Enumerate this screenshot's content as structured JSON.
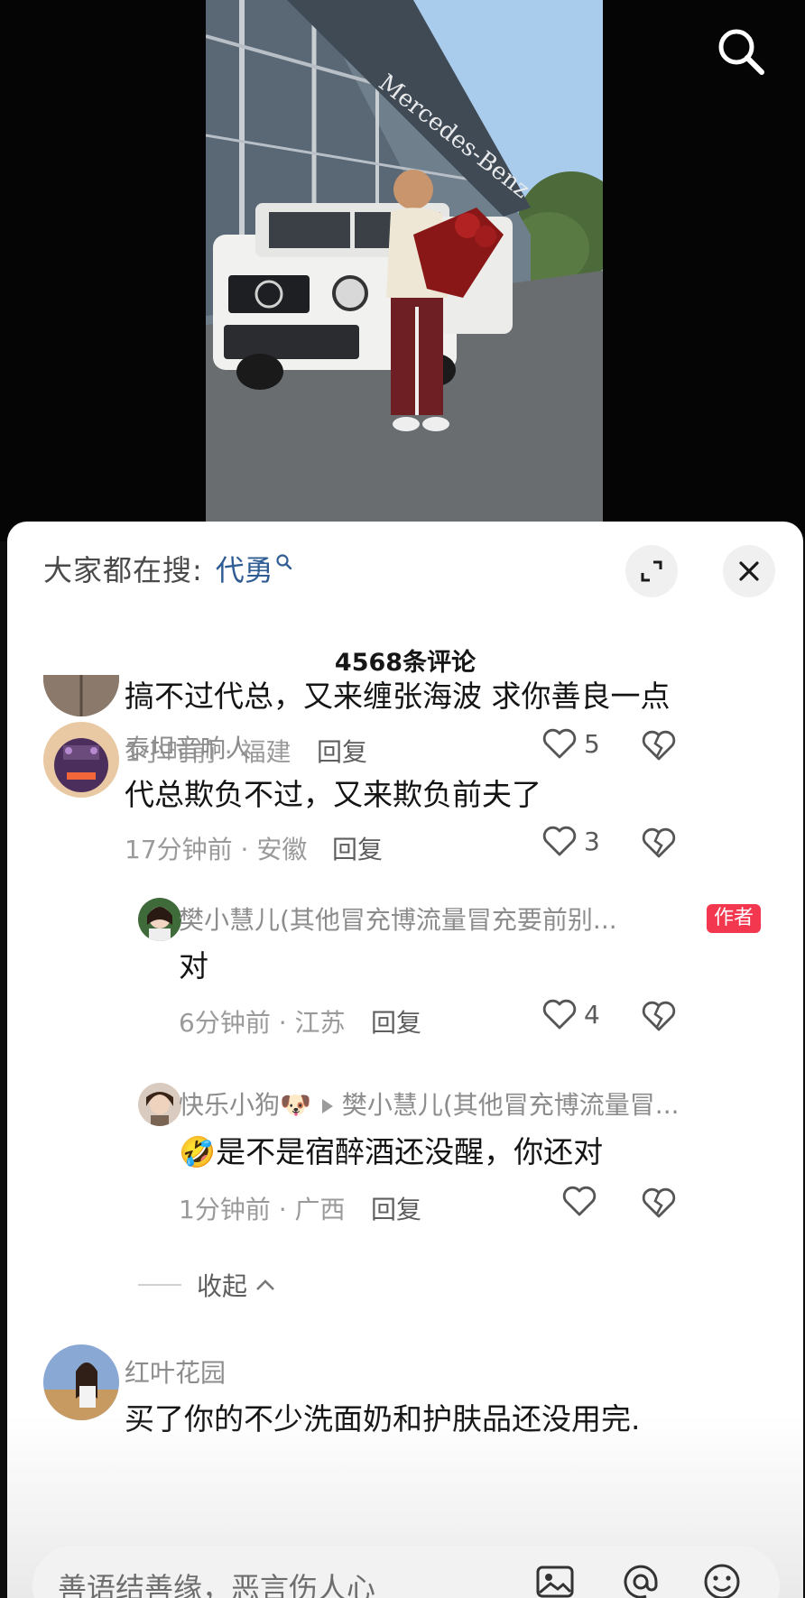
{
  "video": {
    "storefront_text": "Mercedes-Benz",
    "search_icon": "search-icon"
  },
  "sheet": {
    "trend_label": "大家都在搜:",
    "trend_keyword": "代勇",
    "count_label": "4568条评论"
  },
  "comments": [
    {
      "text": "搞不过代总，又来缠张海波 求你善良一点",
      "meta": "1小时前 · 福建",
      "reply": "回复",
      "likes": "5"
    },
    {
      "author": "泰坦音响人",
      "text": "代总欺负不过，又来欺负前夫了",
      "meta": "17分钟前 · 安徽",
      "reply": "回复",
      "likes": "3",
      "replies": [
        {
          "author": "樊小慧儿(其他冒充博流量冒充要前别...",
          "badge": "作者",
          "text": "对",
          "meta": "6分钟前 · 江苏",
          "reply": "回复",
          "likes": "4"
        },
        {
          "author": "快乐小狗🐶",
          "reply_to": "樊小慧儿(其他冒充博流量冒...",
          "text": "是不是宿醉酒还没醒，你还对",
          "emoji": "🤣",
          "meta": "1分钟前 · 广西",
          "reply": "回复"
        }
      ],
      "collapse_label": "收起"
    },
    {
      "author": "红叶花园",
      "text": "买了你的不少洗面奶和护肤品还没用完."
    }
  ],
  "input": {
    "placeholder": "善语结善缘，恶言伤人心"
  },
  "colors": {
    "link": "#2f5c93",
    "badge": "#f2374f",
    "text": "#141414",
    "muted": "#9a9a9a"
  }
}
